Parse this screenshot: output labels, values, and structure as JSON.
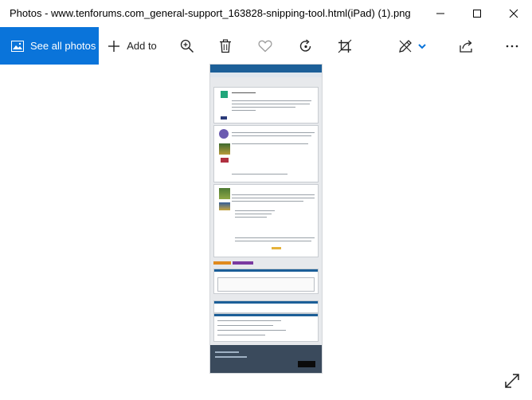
{
  "window": {
    "title": "Photos - www.tenforums.com_general-support_163828-snipping-tool.html(iPad) (1).png"
  },
  "window_controls": {
    "minimize_icon": "minimize-icon",
    "maximize_icon": "maximize-icon",
    "close_icon": "close-icon"
  },
  "toolbar": {
    "see_all_label": "See all photos",
    "add_to_label": "Add to",
    "icons": [
      "photos-icon",
      "plus-icon",
      "zoom-in-icon",
      "delete-icon",
      "heart-icon",
      "rotate-icon",
      "crop-icon",
      "edit-draw-icon",
      "chevron-down-icon",
      "share-icon",
      "more-icon"
    ],
    "accent_color": "#0a74da"
  },
  "viewer": {
    "image_description_icon": "document-thumbnail",
    "expand_icon": "expand-icon"
  }
}
